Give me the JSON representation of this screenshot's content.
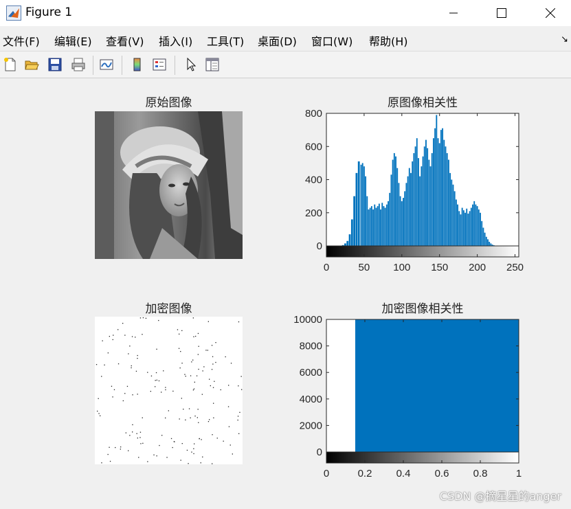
{
  "window": {
    "title": "Figure 1"
  },
  "menu": [
    "文件(F)",
    "编辑(E)",
    "查看(V)",
    "插入(I)",
    "工具(T)",
    "桌面(D)",
    "窗口(W)",
    "帮助(H)"
  ],
  "toolbar_icons": [
    "new-figure-icon",
    "open-file-icon",
    "save-icon",
    "print-icon",
    "link-plot-icon",
    "colorbar-icon",
    "legend-icon",
    "pointer-icon",
    "property-inspector-icon"
  ],
  "panels": {
    "original_title": "原始图像",
    "encrypted_title": "加密图像"
  },
  "colors": {
    "bar": "#0072bd",
    "axis": "#262626"
  },
  "chart_data": [
    {
      "type": "bar",
      "title": "原图像相关性",
      "xlabel": "",
      "ylabel": "",
      "xlim": [
        0,
        255
      ],
      "ylim": [
        0,
        800
      ],
      "xticks": [
        0,
        50,
        100,
        150,
        200,
        250
      ],
      "yticks": [
        0,
        200,
        400,
        600,
        800
      ],
      "colorbar": "gray",
      "grid": false,
      "bins_x": [
        0,
        10,
        20,
        22,
        25,
        28,
        31,
        34,
        37,
        40,
        43,
        46,
        48,
        50,
        52,
        54,
        56,
        58,
        60,
        62,
        64,
        66,
        68,
        70,
        72,
        74,
        76,
        78,
        80,
        82,
        84,
        86,
        88,
        90,
        92,
        94,
        96,
        98,
        100,
        102,
        104,
        106,
        108,
        110,
        112,
        114,
        116,
        118,
        120,
        122,
        124,
        126,
        128,
        130,
        132,
        134,
        136,
        138,
        140,
        142,
        144,
        146,
        148,
        150,
        152,
        154,
        156,
        158,
        160,
        162,
        164,
        166,
        168,
        170,
        172,
        174,
        176,
        178,
        180,
        182,
        184,
        186,
        188,
        190,
        192,
        194,
        196,
        198,
        200,
        202,
        204,
        206,
        208,
        210,
        212,
        214,
        216,
        218,
        220,
        222,
        224,
        226,
        228,
        230,
        235,
        240,
        245,
        250,
        255
      ],
      "values": [
        0,
        0,
        0,
        5,
        15,
        30,
        70,
        160,
        300,
        440,
        510,
        490,
        500,
        480,
        420,
        300,
        220,
        230,
        240,
        220,
        250,
        230,
        240,
        255,
        220,
        260,
        240,
        230,
        250,
        270,
        320,
        430,
        520,
        560,
        540,
        470,
        380,
        300,
        270,
        290,
        330,
        380,
        420,
        470,
        440,
        510,
        560,
        600,
        650,
        530,
        420,
        480,
        540,
        600,
        640,
        590,
        520,
        480,
        560,
        650,
        710,
        790,
        650,
        620,
        700,
        710,
        640,
        600,
        560,
        520,
        440,
        400,
        370,
        330,
        280,
        250,
        210,
        190,
        230,
        215,
        200,
        225,
        195,
        210,
        230,
        250,
        270,
        250,
        240,
        220,
        200,
        150,
        110,
        80,
        55,
        40,
        25,
        15,
        8,
        4,
        2,
        0,
        0,
        0,
        0,
        0,
        0,
        0,
        0
      ]
    },
    {
      "type": "bar",
      "title": "加密图像相关性",
      "xlabel": "",
      "ylabel": "",
      "xlim": [
        0,
        1
      ],
      "ylim": [
        0,
        10000
      ],
      "xticks": [
        0,
        0.2,
        0.4,
        0.6,
        0.8,
        1
      ],
      "yticks": [
        0,
        2000,
        4000,
        6000,
        8000,
        10000
      ],
      "colorbar": "gray",
      "grid": false,
      "bins_x": [
        0,
        1
      ],
      "values": [
        0,
        10000
      ]
    }
  ],
  "watermark": "CSDN @摘星星的anger"
}
